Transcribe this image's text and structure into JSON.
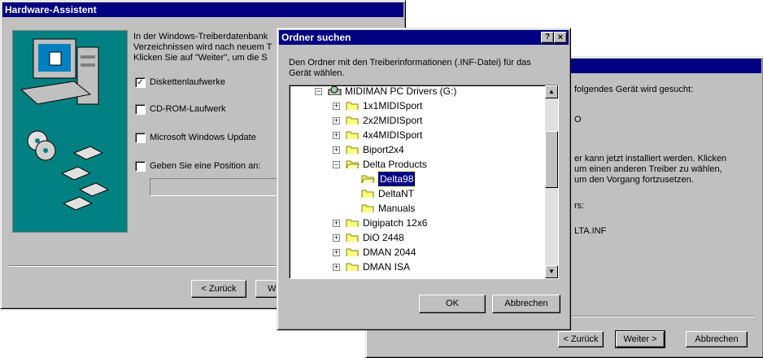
{
  "hw_wizard": {
    "title": "Hardware-Assistent",
    "intro_lines": [
      "In der Windows-Treiberdatenbank",
      "Verzeichnissen wird nach neuem T",
      "Klicken Sie auf \"Weiter\", um die S"
    ],
    "options": [
      {
        "label": "Diskettenlaufwerke",
        "checked": true
      },
      {
        "label": "CD-ROM-Laufwerk",
        "checked": false
      },
      {
        "label": "Microsoft Windows Update",
        "checked": false
      },
      {
        "label": "Geben Sie eine Position an:",
        "checked": false
      }
    ],
    "back_label": "< Zurück",
    "next_label": "W"
  },
  "bg_wizard": {
    "lines": [
      "folgendes Gerät wird gesucht:",
      "O",
      "er kann jetzt installiert werden. Klicken",
      "um einen anderen Treiber zu wählen,",
      "um den Vorgang fortzusetzen.",
      "rs:",
      "LTA.INF"
    ],
    "back_label": "< Zurück",
    "next_label": "Weiter >",
    "cancel_label": "Abbrechen"
  },
  "folder_dialog": {
    "title": "Ordner suchen",
    "help_label": "?",
    "close_label": "×",
    "description": "Den Ordner mit den Treiberinformationen (.INF-Datei) für das Gerät wählen.",
    "tree": [
      {
        "label": "MIDIMAN  PC Drivers (G:)",
        "level": 0,
        "expander": "-",
        "icon": "drive"
      },
      {
        "label": "1x1MIDISport",
        "level": 1,
        "expander": "+",
        "icon": "folder"
      },
      {
        "label": "2x2MIDISport",
        "level": 1,
        "expander": "+",
        "icon": "folder"
      },
      {
        "label": "4x4MIDISport",
        "level": 1,
        "expander": "+",
        "icon": "folder"
      },
      {
        "label": "Biport2x4",
        "level": 1,
        "expander": "+",
        "icon": "folder"
      },
      {
        "label": "Delta Products",
        "level": 1,
        "expander": "-",
        "icon": "folder-open"
      },
      {
        "label": "Delta98",
        "level": 2,
        "expander": "",
        "icon": "folder-open",
        "selected": true
      },
      {
        "label": "DeltaNT",
        "level": 2,
        "expander": "",
        "icon": "folder"
      },
      {
        "label": "Manuals",
        "level": 2,
        "expander": "",
        "icon": "folder"
      },
      {
        "label": "Digipatch 12x6",
        "level": 1,
        "expander": "+",
        "icon": "folder"
      },
      {
        "label": "DiO 2448",
        "level": 1,
        "expander": "+",
        "icon": "folder"
      },
      {
        "label": "DMAN 2044",
        "level": 1,
        "expander": "+",
        "icon": "folder"
      },
      {
        "label": "DMAN ISA",
        "level": 1,
        "expander": "+",
        "icon": "folder"
      }
    ],
    "ok_label": "OK",
    "cancel_label": "Abbrechen"
  }
}
